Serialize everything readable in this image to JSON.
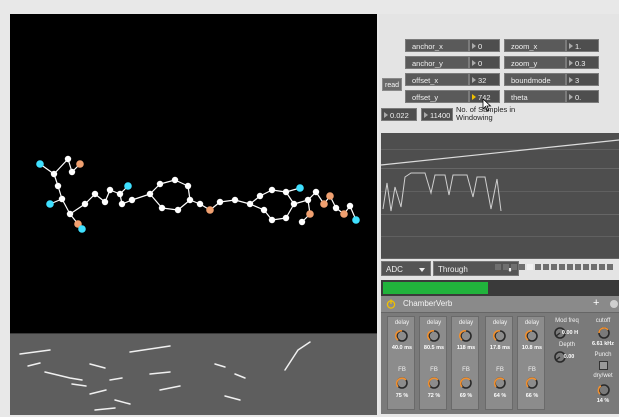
{
  "params": {
    "anchor_x": {
      "label": "anchor_x",
      "value": "0"
    },
    "anchor_y": {
      "label": "anchor_y",
      "value": "0"
    },
    "offset_x": {
      "label": "offset_x",
      "value": "32"
    },
    "offset_y": {
      "label": "offset_y",
      "value": "742"
    },
    "zoom_x": {
      "label": "zoom_x",
      "value": "1."
    },
    "zoom_y": {
      "label": "zoom_y",
      "value": "0.3"
    },
    "boundmode": {
      "label": "boundmode",
      "value": "3"
    },
    "theta": {
      "label": "theta",
      "value": "0."
    }
  },
  "read_label": "read",
  "small_value": "0.022",
  "samples_value": "11400",
  "samples_caption": "No. of Samples in Windowing",
  "menus": {
    "input": "ADC",
    "mode": "Through"
  },
  "meter_level": 0.45,
  "device": {
    "name": "ChamberVerb",
    "add_label": "+",
    "cols": [
      {
        "delay_label": "delay",
        "delay_val": "40.0 ms",
        "fb_label": "FB",
        "fb_val": "75 %"
      },
      {
        "delay_label": "delay",
        "delay_val": "80.5 ms",
        "fb_label": "FB",
        "fb_val": "72 %"
      },
      {
        "delay_label": "delay",
        "delay_val": "118 ms",
        "fb_label": "FB",
        "fb_val": "69 %"
      },
      {
        "delay_label": "delay",
        "delay_val": "17.8 ms",
        "fb_label": "FB",
        "fb_val": "64 %"
      },
      {
        "delay_label": "delay",
        "delay_val": "10.8 ms",
        "fb_label": "FB",
        "fb_val": "66 %"
      }
    ],
    "mod_freq_label": "Mod freq",
    "mod_freq_val": "0.00 H",
    "depth_label": "Depth",
    "depth_val": "0.00",
    "cutoff_label": "cutoff",
    "cutoff_val": "6.61 kHz",
    "punch_label": "Punch",
    "drywet_label": "dry/wet",
    "drywet_val": "14 %"
  },
  "colors": {
    "meter": "#21b33c",
    "atom_white": "#ffffff",
    "atom_cyan": "#3fe0ff",
    "atom_orange": "#f0a070",
    "bond": "#ffffff"
  }
}
